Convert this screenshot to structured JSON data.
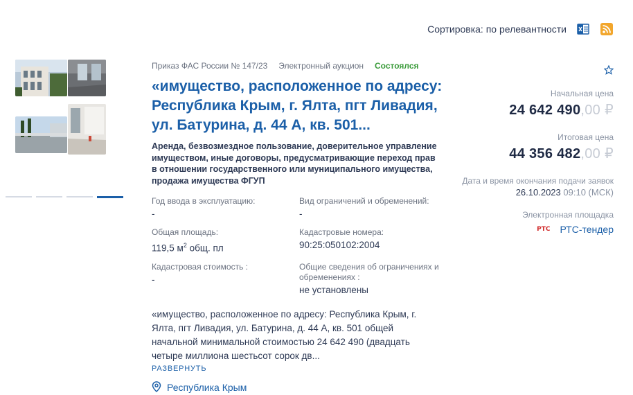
{
  "toolbar": {
    "sort_label": "Сортировка: по релевантности",
    "icons": [
      "excel-export-icon",
      "rss-icon"
    ]
  },
  "listing": {
    "order": "Приказ ФАС России № 147/23",
    "type": "Электронный аукцион",
    "status": "Состоялся",
    "title": "«имущество, расположенное по адресу: Республика Крым, г. Ялта, пгт Ливадия, ул. Батурина, д. 44 А, кв. 501...",
    "description": "Аренда, безвозмездное пользование, доверительное управление имуществом, иные договоры, предусматривающие переход прав в отношении государственного или муниципального имущества, продажа имущества ФГУП",
    "props": {
      "year_label": "Год ввода в эксплуатацию:",
      "year_value": "-",
      "restrictions_label": "Вид ограничений и обременений:",
      "restrictions_value": "-",
      "area_label": "Общая площадь:",
      "area_value_prefix": "119,5 м",
      "area_value_sup": "2",
      "area_value_suffix": " общ. пл",
      "cadastral_numbers_label": "Кадастровые номера:",
      "cadastral_numbers_value": "90:25:050102:2004",
      "cadastral_cost_label": "Кадастровая стоимость :",
      "cadastral_cost_value": "-",
      "general_restrictions_label": "Общие сведения об ограничениях и обременениях :",
      "general_restrictions_value": "не установлены"
    },
    "full_description": "«имущество, расположенное по адресу: Республика Крым, г. Ялта, пгт Ливадия, ул. Батурина, д. 44 А, кв. 501 общей начальной минимальной стоимостью 24 642 490 (двадцать четыре миллиона шестьсот сорок дв...",
    "expand_label": "РАЗВЕРНУТЬ",
    "region": "Республика Крым"
  },
  "pricing": {
    "start_label": "Начальная цена",
    "start_main": "24 642 490",
    "start_cents": ",00 ₽",
    "final_label": "Итоговая цена",
    "final_main": "44 356 482",
    "final_cents": ",00 ₽",
    "deadline_label": "Дата и время окончания подачи заявок",
    "deadline_date": "26.10.2023",
    "deadline_time": "09:10 (МСК)",
    "platform_label": "Электронная площадка",
    "platform_logo_text": "РТС",
    "platform_name": "РТС-тендер"
  },
  "gallery": {
    "photo_count": 4,
    "active_slide": 4,
    "slide_count": 4
  },
  "colors": {
    "accent": "#1b5fa8",
    "status_green": "#3a9b3a",
    "muted": "#8a93a3"
  }
}
